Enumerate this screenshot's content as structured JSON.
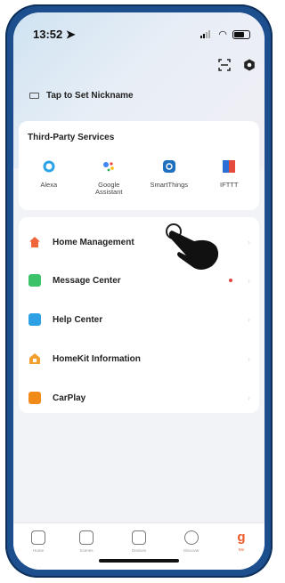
{
  "status_bar": {
    "time": "13:52",
    "location_icon": "location-arrow-icon"
  },
  "header": {
    "scan_icon": "scan-icon",
    "settings_icon": "gear-icon",
    "nickname_prompt": "Tap to Set Nickname"
  },
  "third_party": {
    "title": "Third-Party Services",
    "items": [
      {
        "label": "Alexa",
        "icon": "alexa-icon",
        "color": "#2aa3e6"
      },
      {
        "label": "Google Assistant",
        "icon": "google-assistant-icon",
        "color": "#4285f4"
      },
      {
        "label": "SmartThings",
        "icon": "smartthings-icon",
        "color": "#1f6fbf"
      },
      {
        "label": "IFTTT",
        "icon": "ifttt-icon",
        "color": "#e54b3c"
      }
    ]
  },
  "menu": {
    "items": [
      {
        "label": "Home Management",
        "icon": "home-icon",
        "color": "#f0663a"
      },
      {
        "label": "Message Center",
        "icon": "message-icon",
        "color": "#3cc36a",
        "badge_color": "#e64040"
      },
      {
        "label": "Help Center",
        "icon": "help-icon",
        "color": "#2ea0e6"
      },
      {
        "label": "HomeKit Information",
        "icon": "homekit-icon",
        "color": "#f2a02f"
      },
      {
        "label": "CarPlay",
        "icon": "carplay-icon",
        "color": "#f28a1a"
      }
    ]
  },
  "tabbar": {
    "tabs": [
      {
        "label": "Home",
        "icon": "home-tab-icon"
      },
      {
        "label": "Scenes",
        "icon": "scenes-tab-icon"
      },
      {
        "label": "Devices",
        "icon": "devices-tab-icon"
      },
      {
        "label": "Discover",
        "icon": "discover-tab-icon"
      },
      {
        "label": "Me",
        "icon": "me-tab-icon",
        "active": true,
        "color": "#f05a28"
      }
    ]
  }
}
